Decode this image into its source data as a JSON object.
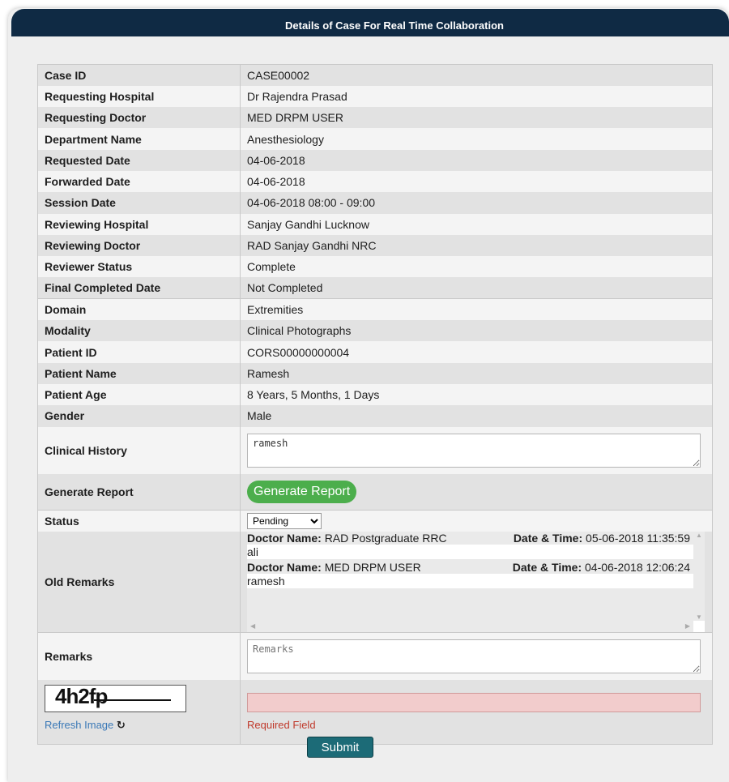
{
  "header": {
    "title": "Details of Case For Real Time Collaboration"
  },
  "details": [
    {
      "label": "Case ID",
      "value": "CASE00002"
    },
    {
      "label": "Requesting Hospital",
      "value": "Dr Rajendra Prasad"
    },
    {
      "label": "Requesting Doctor",
      "value": "MED DRPM USER"
    },
    {
      "label": "Department Name",
      "value": "Anesthesiology"
    },
    {
      "label": "Requested Date",
      "value": "04-06-2018"
    },
    {
      "label": "Forwarded Date",
      "value": "04-06-2018"
    },
    {
      "label": "Session Date",
      "value": "04-06-2018 08:00 - 09:00"
    },
    {
      "label": "Reviewing Hospital",
      "value": "Sanjay Gandhi Lucknow"
    },
    {
      "label": "Reviewing Doctor",
      "value": "RAD Sanjay Gandhi NRC"
    },
    {
      "label": "Reviewer Status",
      "value": "Complete"
    },
    {
      "label": "Final Completed Date",
      "value": "Not Completed"
    },
    {
      "label": "Domain",
      "value": "Extremities"
    },
    {
      "label": "Modality",
      "value": "Clinical Photographs"
    },
    {
      "label": "Patient ID",
      "value": "CORS00000000004"
    },
    {
      "label": "Patient Name",
      "value": "Ramesh"
    },
    {
      "label": "Patient Age",
      "value": "8 Years, 5 Months, 1 Days"
    },
    {
      "label": "Gender",
      "value": "Male"
    }
  ],
  "clinical_history": {
    "label": "Clinical History",
    "value": "ramesh"
  },
  "generate_report": {
    "label": "Generate Report",
    "button": "Generate Report",
    "button_color": "#4cae4c"
  },
  "status": {
    "label": "Status",
    "selected": "Pending"
  },
  "old_remarks": {
    "label": "Old Remarks",
    "doctor_label": "Doctor Name:",
    "datetime_label": "Date & Time:",
    "items": [
      {
        "doctor": "RAD Postgraduate RRC",
        "datetime": "05-06-2018 11:35:59",
        "text": "ali"
      },
      {
        "doctor": "MED DRPM USER",
        "datetime": "04-06-2018 12:06:24",
        "text": "ramesh"
      }
    ]
  },
  "remarks": {
    "label": "Remarks",
    "placeholder": "Remarks"
  },
  "captcha": {
    "text": "4h2fp",
    "refresh_label": "Refresh Image",
    "required_text": "Required Field"
  },
  "submit": {
    "label": "Submit",
    "color": "#1c6b77"
  },
  "colors": {
    "header_bg": "#0f2a44",
    "panel_bg": "#eeeeee",
    "error_bg": "#f2cccc"
  }
}
